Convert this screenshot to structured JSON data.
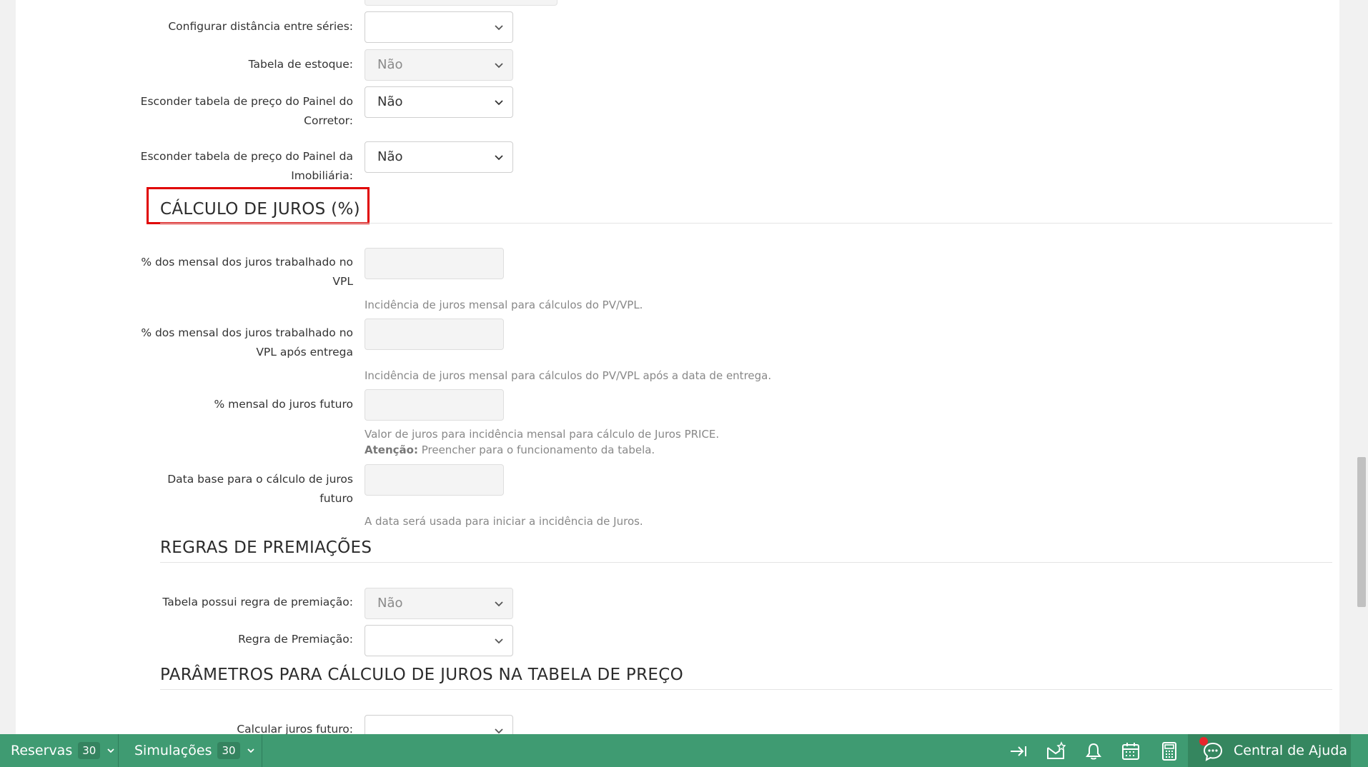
{
  "form_top": {
    "fields": [
      {
        "label": "Configurar distância entre séries:",
        "value": ""
      },
      {
        "label": "Tabela de estoque:",
        "value": "Não"
      },
      {
        "label": "Esconder tabela de preço do Painel do Corretor:",
        "value": "Não"
      },
      {
        "label": "Esconder tabela de preço do Painel da Imobiliária:",
        "value": "Não"
      }
    ]
  },
  "juros": {
    "title": "CÁLCULO DE JUROS (%)",
    "fields": [
      {
        "label": "% dos mensal dos juros trabalhado no VPL",
        "help": "Incidência de juros mensal para cálculos do PV/VPL."
      },
      {
        "label": "% dos mensal dos juros trabalhado no VPL após entrega",
        "help": "Incidência de juros mensal para cálculos do PV/VPL após a data de entrega."
      },
      {
        "label": "% mensal do juros futuro",
        "help": "Valor de juros para incidência mensal para cálculo de Juros PRICE.",
        "attention_label": "Atenção:",
        "attention_text": " Preencher para o funcionamento da tabela."
      },
      {
        "label": "Data base para o cálculo de juros futuro",
        "help": "A data será usada para iniciar a incidência de Juros."
      }
    ]
  },
  "premiacoes": {
    "title": "REGRAS DE PREMIAÇÕES",
    "fields": [
      {
        "label": "Tabela possui regra de premiação:",
        "value": "Não"
      },
      {
        "label": "Regra de Premiação:",
        "value": ""
      }
    ]
  },
  "parametros": {
    "title": "PARÂMETROS PARA CÁLCULO DE JUROS NA TABELA DE PREÇO",
    "fields": [
      {
        "label": "Calcular juros futuro:",
        "value": ""
      }
    ]
  },
  "bottombar": {
    "reservas_label": "Reservas",
    "reservas_count": "30",
    "simulacoes_label": "Simulações",
    "simulacoes_count": "30",
    "icons": [
      "collapse-arrow-icon",
      "mail-star-icon",
      "bell-icon",
      "calendar-icon",
      "calculator-icon",
      "chat-icon"
    ],
    "help_label": "Central de Ajuda",
    "accent_color": "#3f9b72",
    "notification_color": "#e8262c"
  }
}
